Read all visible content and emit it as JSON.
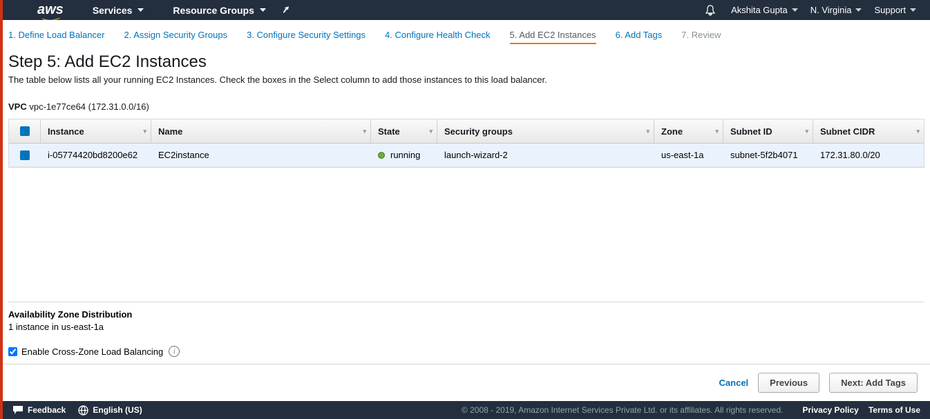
{
  "topbar": {
    "logo": "aws",
    "services": "Services",
    "resource_groups": "Resource Groups",
    "user": "Akshita Gupta",
    "region": "N. Virginia",
    "support": "Support"
  },
  "wizard": {
    "steps": [
      "1. Define Load Balancer",
      "2. Assign Security Groups",
      "3. Configure Security Settings",
      "4. Configure Health Check",
      "5. Add EC2 Instances",
      "6. Add Tags",
      "7. Review"
    ],
    "active_index": 4
  },
  "page": {
    "title": "Step 5: Add EC2 Instances",
    "desc": "The table below lists all your running EC2 Instances. Check the boxes in the Select column to add those instances to this load balancer.",
    "vpc_label": "VPC",
    "vpc_value": "vpc-1e77ce64 (172.31.0.0/16)"
  },
  "table": {
    "headers": {
      "instance": "Instance",
      "name": "Name",
      "state": "State",
      "sg": "Security groups",
      "zone": "Zone",
      "subnet": "Subnet ID",
      "cidr": "Subnet CIDR"
    },
    "rows": [
      {
        "selected": true,
        "instance": "i-05774420bd8200e62",
        "name": "EC2instance",
        "state": "running",
        "sg": "launch-wizard-2",
        "zone": "us-east-1a",
        "subnet": "subnet-5f2b4071",
        "cidr": "172.31.80.0/20"
      }
    ]
  },
  "az": {
    "heading": "Availability Zone Distribution",
    "text": "1 instance in us-east-1a"
  },
  "crosszone": {
    "label": "Enable Cross-Zone Load Balancing",
    "checked": true
  },
  "buttons": {
    "cancel": "Cancel",
    "previous": "Previous",
    "next": "Next: Add Tags"
  },
  "footer": {
    "feedback": "Feedback",
    "lang": "English (US)",
    "copy": "© 2008 - 2019, Amazon Internet Services Private Ltd. or its affiliates. All rights reserved.",
    "privacy": "Privacy Policy",
    "terms": "Terms of Use"
  }
}
